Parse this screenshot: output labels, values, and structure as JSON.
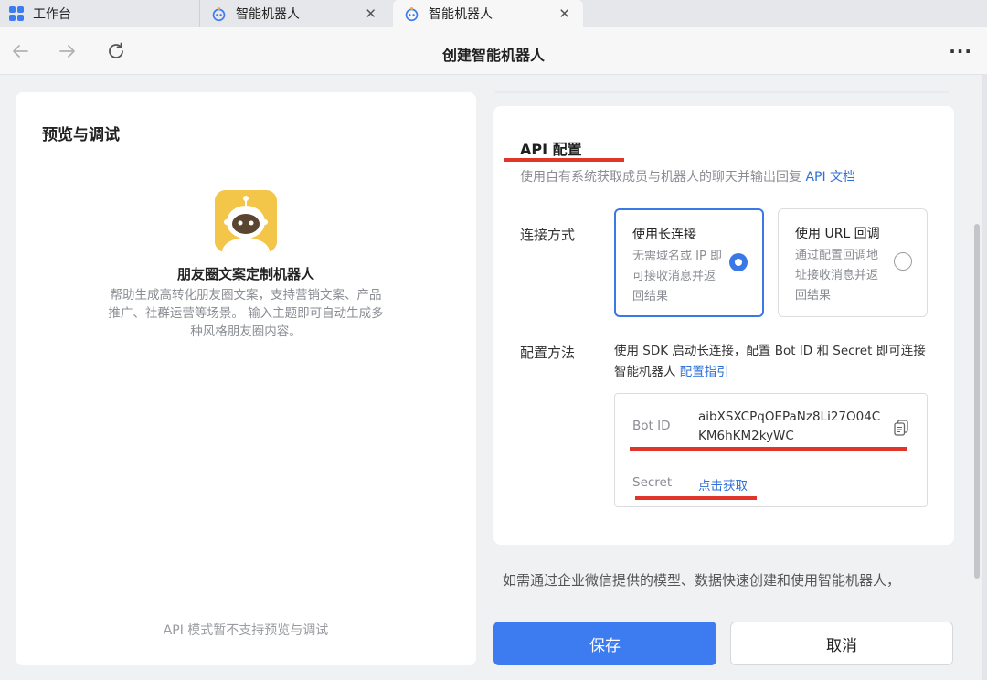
{
  "tabs": [
    {
      "label": "工作台",
      "icon": "grid-icon"
    },
    {
      "label": "智能机器人",
      "icon": "bot-icon"
    },
    {
      "label": "智能机器人",
      "icon": "bot-icon",
      "active": true
    }
  ],
  "nav": {
    "title": "创建智能机器人",
    "more": "···"
  },
  "left": {
    "title": "预览与调试",
    "bot_name": "朋友圈文案定制机器人",
    "bot_desc": "帮助生成高转化朋友圈文案，支持营销文案、产品推广、社群运营等场景。 输入主题即可自动生成多种风格朋友圈内容。",
    "note": "API 模式暂不支持预览与调试"
  },
  "api": {
    "title": "API 配置",
    "desc": "使用自有系统获取成员与机器人的聊天并输出回复",
    "doc_link": "API 文档",
    "connect_label": "连接方式",
    "options": [
      {
        "title": "使用长连接",
        "desc": "无需域名或 IP 即可接收消息并返回结果",
        "selected": true
      },
      {
        "title": "使用 URL 回调",
        "desc": "通过配置回调地址接收消息并返回结果",
        "selected": false
      }
    ],
    "method_label": "配置方法",
    "method_text": "使用 SDK 启动长连接，配置 Bot ID 和 Secret 即可连接智能机器人",
    "method_link": "配置指引",
    "bot_id_label": "Bot ID",
    "bot_id_value": "aibXSXCPqOEPaNz8Li27O04CKM6hKM2kyWC",
    "secret_label": "Secret",
    "secret_link": "点击获取"
  },
  "footer_text": "如需通过企业微信提供的模型、数据快速创建和使用智能机器人，",
  "buttons": {
    "save": "保存",
    "cancel": "取消"
  },
  "colors": {
    "accent": "#3d7bf0",
    "annotation_red": "#e0362a",
    "avatar_yellow": "#f3c64a"
  }
}
